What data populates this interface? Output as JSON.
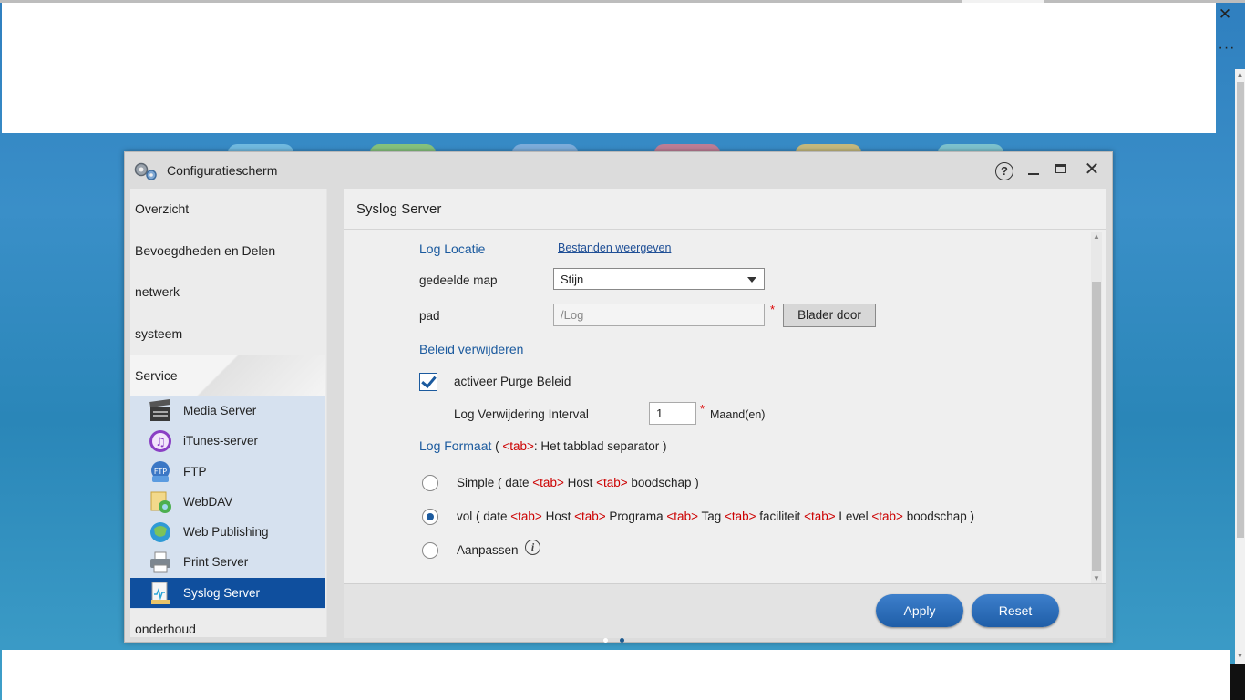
{
  "window": {
    "title": "Configuratiescherm",
    "help_label": "?",
    "close_label": "✕"
  },
  "browser": {
    "close_label": "✕",
    "more_label": "···"
  },
  "sidebar": {
    "items": [
      {
        "label": "Overzicht"
      },
      {
        "label": "Bevoegdheden en Delen"
      },
      {
        "label": "netwerk"
      },
      {
        "label": "systeem"
      },
      {
        "label": "Service"
      },
      {
        "label": "onderhoud"
      }
    ],
    "selected": "Service",
    "subitems": [
      {
        "label": "Media Server",
        "icon": "media-server-icon"
      },
      {
        "label": "iTunes-server",
        "icon": "itunes-icon"
      },
      {
        "label": "FTP",
        "icon": "ftp-icon"
      },
      {
        "label": "WebDAV",
        "icon": "webdav-icon"
      },
      {
        "label": "Web Publishing",
        "icon": "web-publishing-icon"
      },
      {
        "label": "Print Server",
        "icon": "printer-icon"
      },
      {
        "label": "Syslog Server",
        "icon": "syslog-icon"
      }
    ],
    "active_subitem": "Syslog Server"
  },
  "main": {
    "title": "Syslog Server",
    "log_location": {
      "heading": "Log Locatie",
      "link": "Bestanden weergeven",
      "shared_folder_label": "gedeelde map",
      "shared_folder_value": "Stijn",
      "path_label": "pad",
      "path_value": "/Log",
      "required_mark": "*",
      "browse_button": "Blader door"
    },
    "delete_policy": {
      "heading": "Beleid verwijderen",
      "purge_label": "activeer Purge Beleid",
      "purge_checked": true,
      "interval_label": "Log Verwijdering Interval",
      "interval_value": "1",
      "required_mark": "*",
      "interval_unit": "Maand(en)"
    },
    "log_format": {
      "heading": "Log Formaat",
      "heading_open": " ( ",
      "heading_tag": "<tab>",
      "heading_rest": ": Het tabblad separator )",
      "tag": "<tab>",
      "simple": {
        "t1": "Simple ( date ",
        "t2": " Host ",
        "t3": " boodschap )",
        "checked": false
      },
      "full": {
        "t1": "vol ( date ",
        "t2": " Host ",
        "t3": " Programa ",
        "t4": " Tag ",
        "t5": " faciliteit ",
        "t6": " Level ",
        "t7": " boodschap )",
        "checked": true
      },
      "custom": {
        "label": "Aanpassen",
        "checked": false
      },
      "info_glyph": "i"
    },
    "buttons": {
      "apply": "Apply",
      "reset": "Reset"
    }
  },
  "colors": {
    "accent": "#1b5a9e",
    "active_item": "#0f4f9e",
    "tag_red": "#cc0000",
    "button_blue": "#2d6fbd"
  }
}
